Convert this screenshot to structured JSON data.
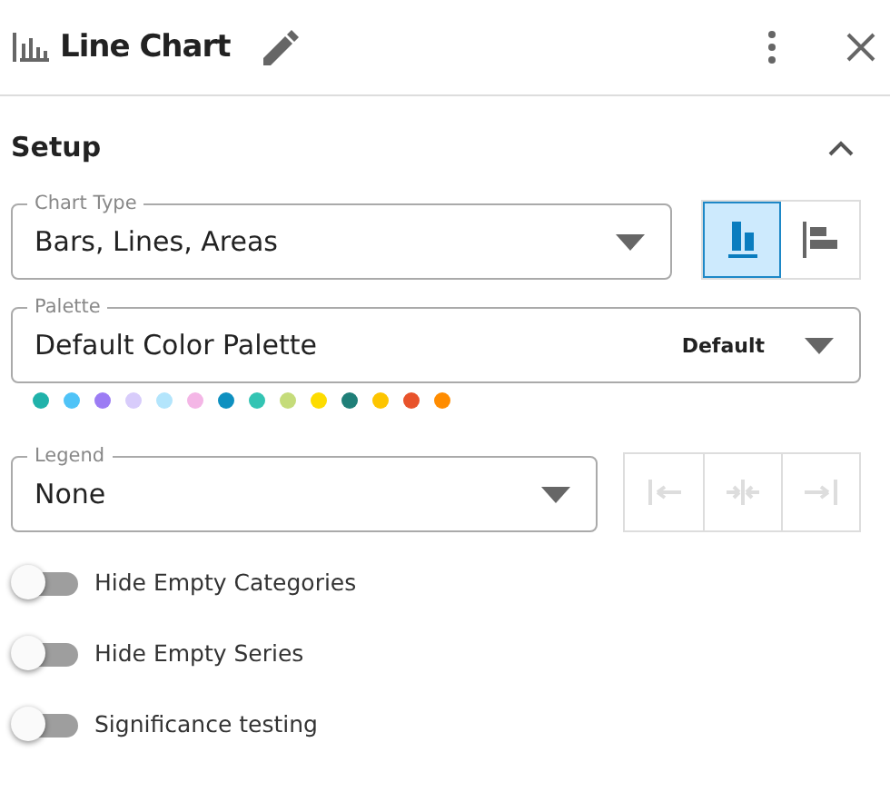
{
  "header": {
    "title": "Line Chart"
  },
  "section": {
    "title": "Setup",
    "expanded": true
  },
  "chart_type": {
    "label": "Chart Type",
    "value": "Bars, Lines, Areas"
  },
  "orientations": [
    {
      "kind": "vertical",
      "selected": true
    },
    {
      "kind": "horizontal",
      "selected": false
    }
  ],
  "palette": {
    "label": "Palette",
    "value": "Default Color Palette",
    "badge": "Default",
    "colors": [
      {
        "color": "#20b2aa"
      },
      {
        "color": "#4fc3f7"
      },
      {
        "color": "#9c7cf4"
      },
      {
        "color": "#d8ccfb"
      },
      {
        "color": "#b3e5fc"
      },
      {
        "color": "#f4b6e6"
      },
      {
        "color": "#0e90c0"
      },
      {
        "color": "#33c4b3"
      },
      {
        "color": "#c5dc7a"
      },
      {
        "color": "#fddc00"
      },
      {
        "color": "#1f7f78"
      },
      {
        "color": "#fdc500"
      },
      {
        "color": "#e8532b"
      },
      {
        "color": "#ff8c00"
      }
    ]
  },
  "legend": {
    "label": "Legend",
    "value": "None"
  },
  "legend_positions": [
    {
      "kind": "left",
      "disabled": true
    },
    {
      "kind": "center",
      "disabled": true
    },
    {
      "kind": "right",
      "disabled": true
    }
  ],
  "toggles": [
    {
      "label": "Hide Empty Categories",
      "on": false
    },
    {
      "label": "Hide Empty Series",
      "on": false
    },
    {
      "label": "Significance testing",
      "on": false
    }
  ]
}
